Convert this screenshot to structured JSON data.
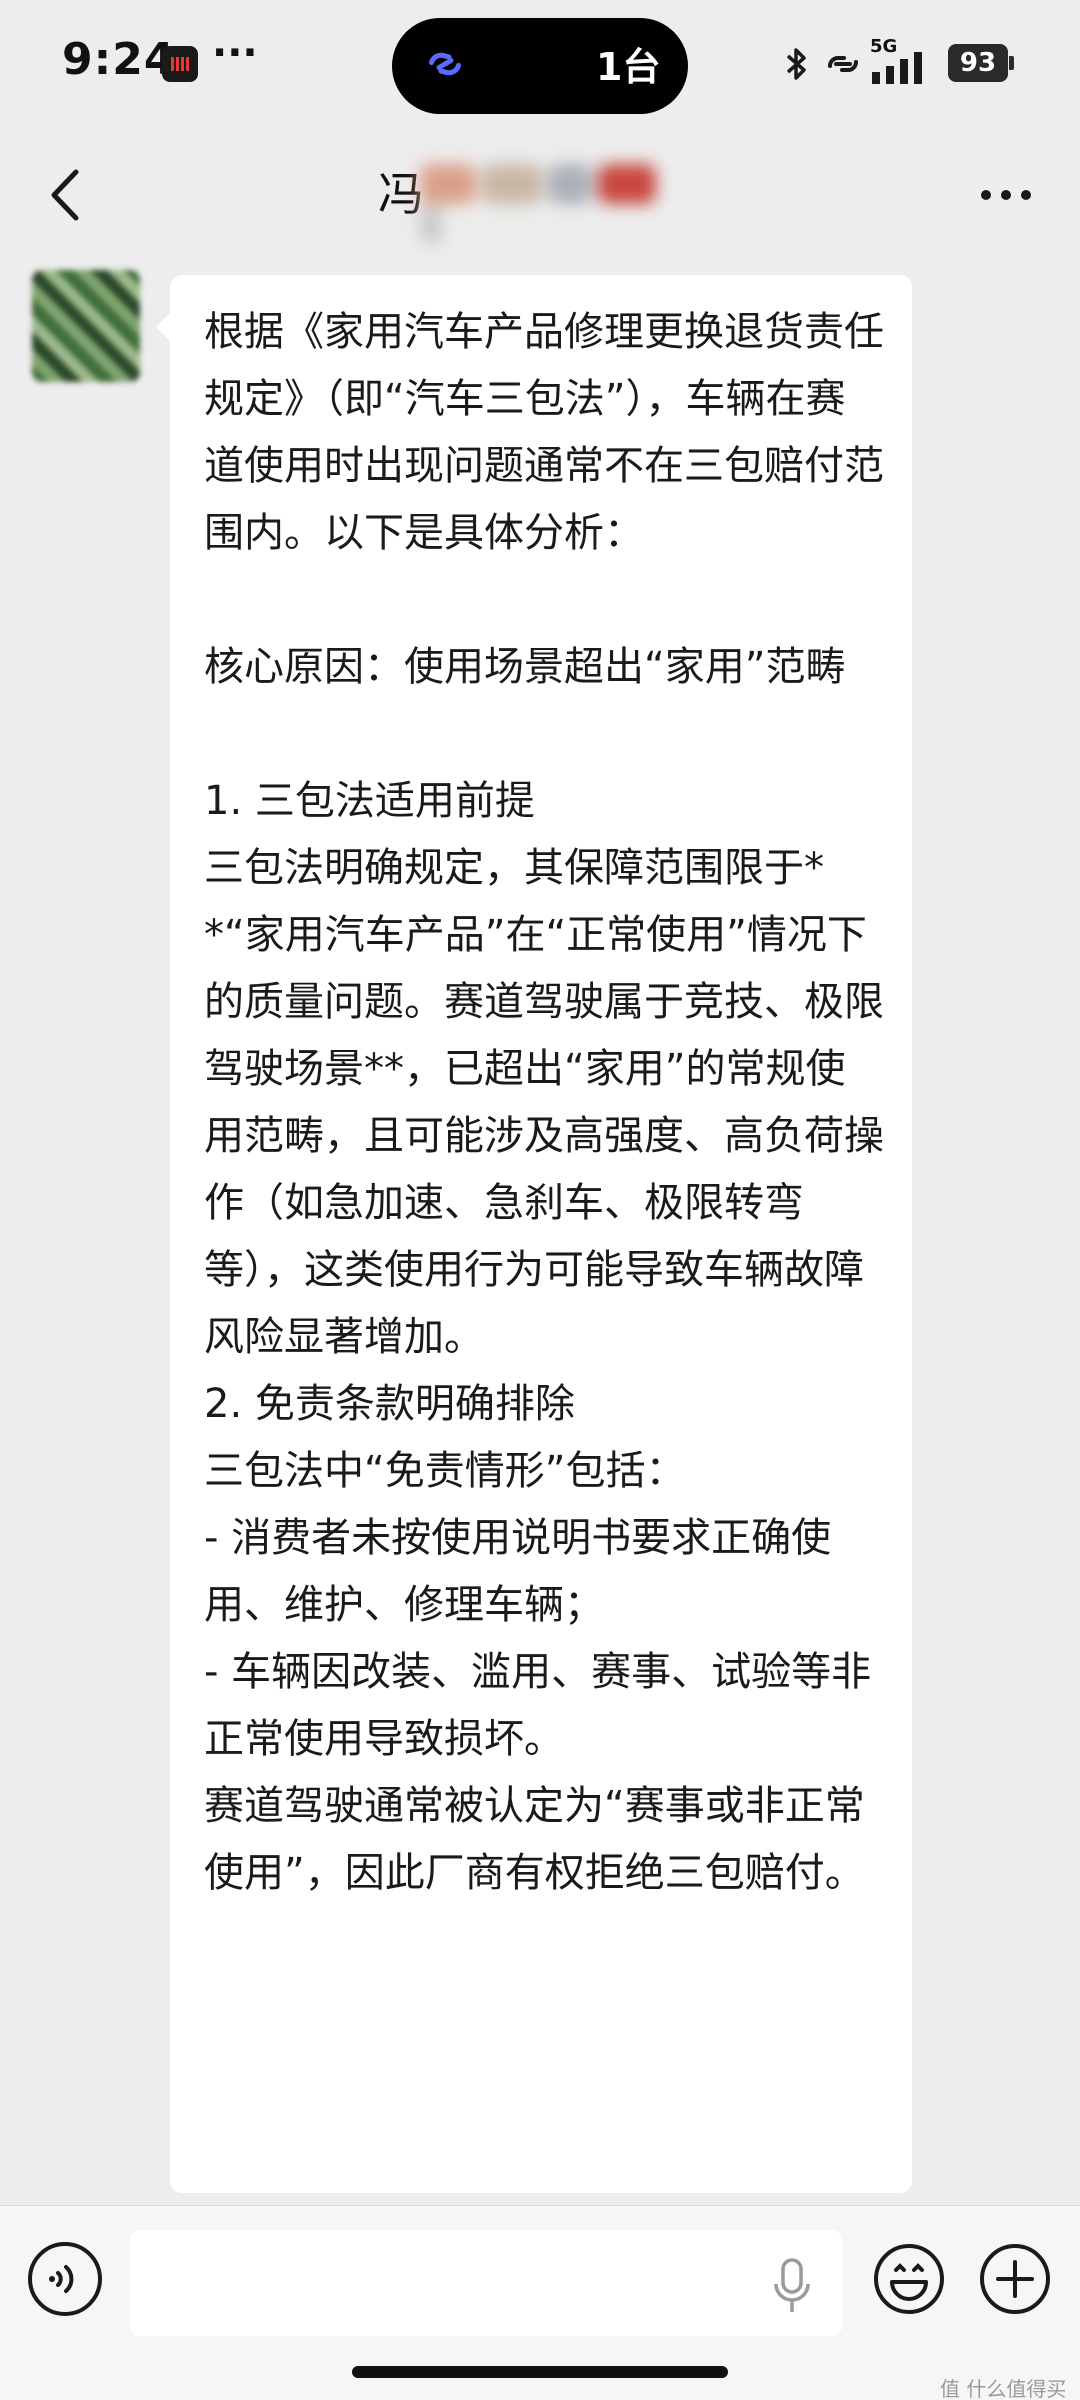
{
  "status_bar": {
    "time": "9:24",
    "more": "···",
    "island_text": "1台",
    "network": "5G",
    "battery": "93"
  },
  "header": {
    "title": "冯"
  },
  "message": {
    "text": "根据《家用汽车产品修理更换退货责任规定》（即“汽车三包法”），车辆在赛道使用时出现问题通常不在三包赔付范围内。以下是具体分析：\n\n核心原因：使用场景超出“家用”范畴\n\n1. 三包法适用前提\n三包法明确规定，其保障范围限于**“家用汽车产品”在“正常使用”情况下的质量问题。赛道驾驶属于竞技、极限驾驶场景**，已超出“家用”的常规使用范畴，且可能涉及高强度、高负荷操作（如急加速、急刹车、极限转弯等），这类使用行为可能导致车辆故障风险显著增加。\n2. 免责条款明确排除\n三包法中“免责情形”包括：\n- 消费者未按使用说明书要求正确使用、维护、修理车辆；\n- 车辆因改装、滥用、赛事、试验等非正常使用导致损坏。\n赛道驾驶通常被认定为“赛事或非正常使用”，因此厂商有权拒绝三包赔付。"
  },
  "input": {
    "value": ""
  },
  "watermark": "值 什么值得买"
}
